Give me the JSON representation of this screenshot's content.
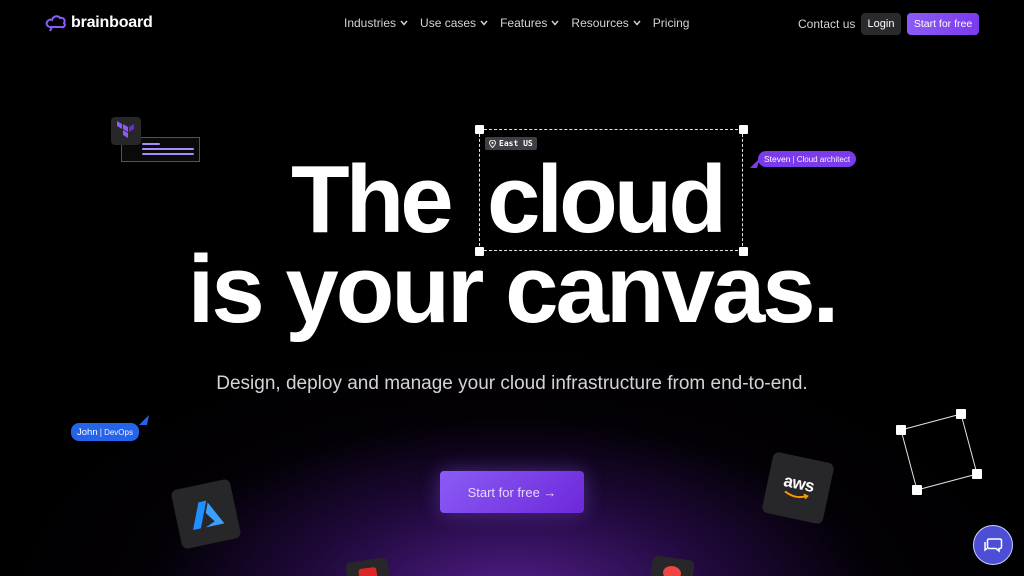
{
  "brand": {
    "name": "brainboard",
    "accent": "#8b5cf6"
  },
  "nav": {
    "menu": [
      {
        "label": "Industries",
        "has_dropdown": true
      },
      {
        "label": "Use cases",
        "has_dropdown": true
      },
      {
        "label": "Features",
        "has_dropdown": true
      },
      {
        "label": "Resources",
        "has_dropdown": true
      },
      {
        "label": "Pricing",
        "has_dropdown": false
      }
    ],
    "contact_label": "Contact us",
    "login_label": "Login",
    "start_label": "Start for free"
  },
  "hero": {
    "word_the": "The",
    "word_cloud": "cloud",
    "line2": "is your canvas.",
    "region_label": "East US",
    "subtitle": "Design, deploy and manage your cloud infrastructure from end-to-end.",
    "cta_label": "Start for free →"
  },
  "cursors": {
    "steven": {
      "name": "Steven",
      "role": "Cloud architect",
      "color": "#7c3aed"
    },
    "john": {
      "name": "John",
      "role": "DevOps",
      "color": "#2563eb"
    }
  },
  "tiles": {
    "aws_label": "aws"
  },
  "icons": [
    "brainboard-logo-icon",
    "chevron-down-icon",
    "location-pin-icon",
    "terraform-icon",
    "azure-icon",
    "aws-icon",
    "chat-icon",
    "cursor-arrow-icon"
  ]
}
